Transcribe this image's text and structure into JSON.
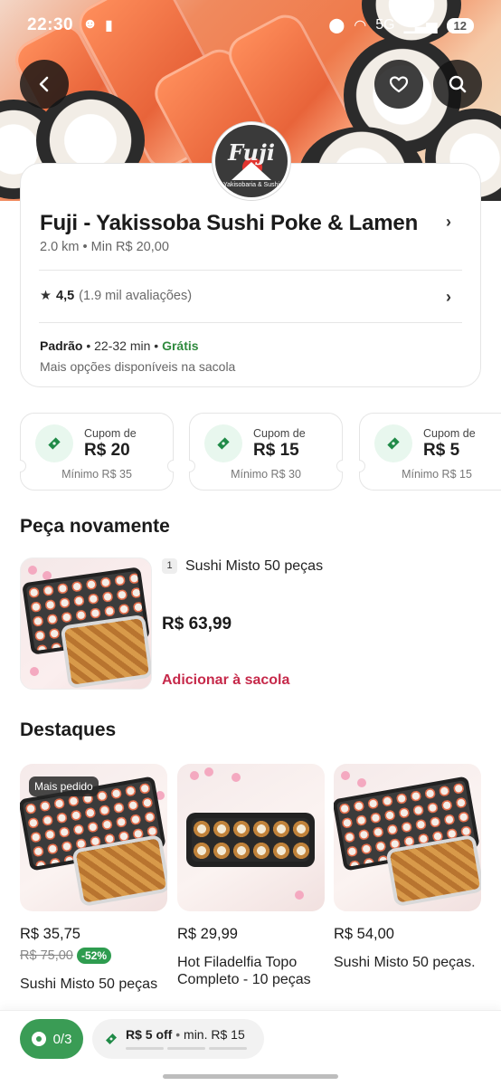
{
  "status_bar": {
    "time": "22:30",
    "battery": "12",
    "network": "5G"
  },
  "store": {
    "logo_text": "Fuji",
    "logo_subtext": "Yakisobaria & Sushi",
    "name": "Fuji - Yakissoba Sushi Poke & Lamen",
    "distance_min": "2.0 km • Min R$ 20,00",
    "rating": "4,5",
    "reviews": "(1.9 mil avaliações)",
    "delivery_type": "Padrão",
    "delivery_time": "• 22-32 min •",
    "delivery_fee": "Grátis",
    "more_options": "Mais opções disponíveis na sacola"
  },
  "coupons": [
    {
      "label": "Cupom de",
      "value": "R$ 20",
      "minimum": "Mínimo R$ 35"
    },
    {
      "label": "Cupom de",
      "value": "R$ 15",
      "minimum": "Mínimo R$ 30"
    },
    {
      "label": "Cupom de",
      "value": "R$ 5",
      "minimum": "Mínimo R$ 15"
    }
  ],
  "reorder": {
    "title": "Peça novamente",
    "qty": "1",
    "item_name": "Sushi Misto 50 peças",
    "price": "R$ 63,99",
    "add_label": "Adicionar à sacola"
  },
  "highlights": {
    "title": "Destaques",
    "items": [
      {
        "badge": "Mais pedido",
        "price": "R$ 35,75",
        "old_price": "R$ 75,00",
        "discount": "-52%",
        "name": "Sushi Misto 50 peças"
      },
      {
        "price": "R$ 29,99",
        "name": "Hot Filadelfia Topo Completo - 10 peças"
      },
      {
        "price": "R$ 54,00",
        "name": "Sushi Misto 50 peças."
      }
    ]
  },
  "bottom_bar": {
    "progress": "0/3",
    "offer_value": "R$ 5 off",
    "offer_sep": "•",
    "offer_min": "min. R$ 15"
  },
  "colors": {
    "accent_red": "#c6294a",
    "green": "#2f8a3e",
    "pill_green": "#3a9c55"
  }
}
